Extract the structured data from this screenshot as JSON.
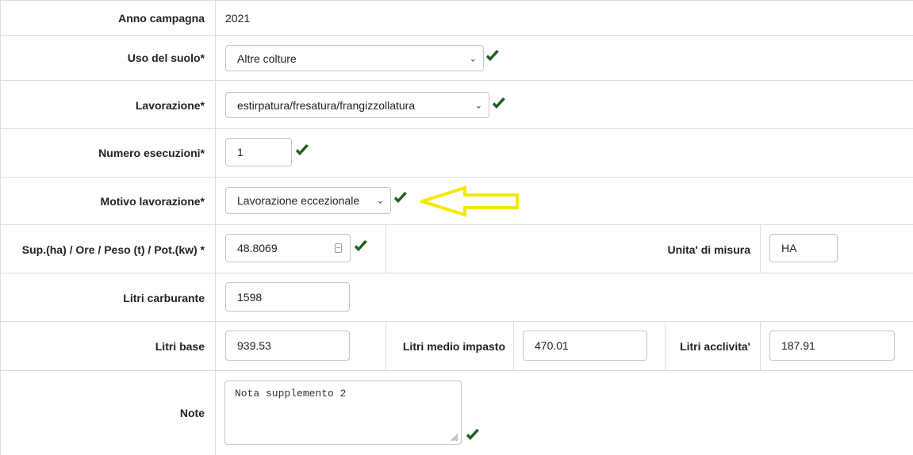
{
  "form": {
    "anno_campagna": {
      "label": "Anno campagna",
      "value": "2021"
    },
    "uso_suolo": {
      "label": "Uso del suolo*",
      "value": "Altre colture"
    },
    "lavorazione": {
      "label": "Lavorazione*",
      "value": "estirpatura/fresatura/frangizzollatura"
    },
    "numero_esecuzioni": {
      "label": "Numero esecuzioni*",
      "value": "1"
    },
    "motivo_lavorazione": {
      "label": "Motivo lavorazione*",
      "value": "Lavorazione eccezionale"
    },
    "superficie": {
      "label": "Sup.(ha) / Ore / Peso (t) / Pot.(kw) *",
      "value": "48.8069"
    },
    "unita_misura": {
      "label": "Unita' di misura",
      "value": "HA"
    },
    "litri_carburante": {
      "label": "Litri carburante",
      "value": "1598"
    },
    "litri_base": {
      "label": "Litri base",
      "value": "939.53"
    },
    "litri_medio_impasto": {
      "label": "Litri medio impasto",
      "value": "470.01"
    },
    "litri_acclivita": {
      "label": "Litri acclivita'",
      "value": "187.91"
    },
    "note": {
      "label": "Note",
      "value": "Nota supplemento 2"
    }
  },
  "icons": {
    "validation": "check-icon",
    "highlight": "arrow-left-outline-icon",
    "dropdown": "chevron-down-icon"
  },
  "colors": {
    "check": "#1f5e1f",
    "highlight_arrow": "#f2ea00",
    "border": "#dcdcdc"
  }
}
